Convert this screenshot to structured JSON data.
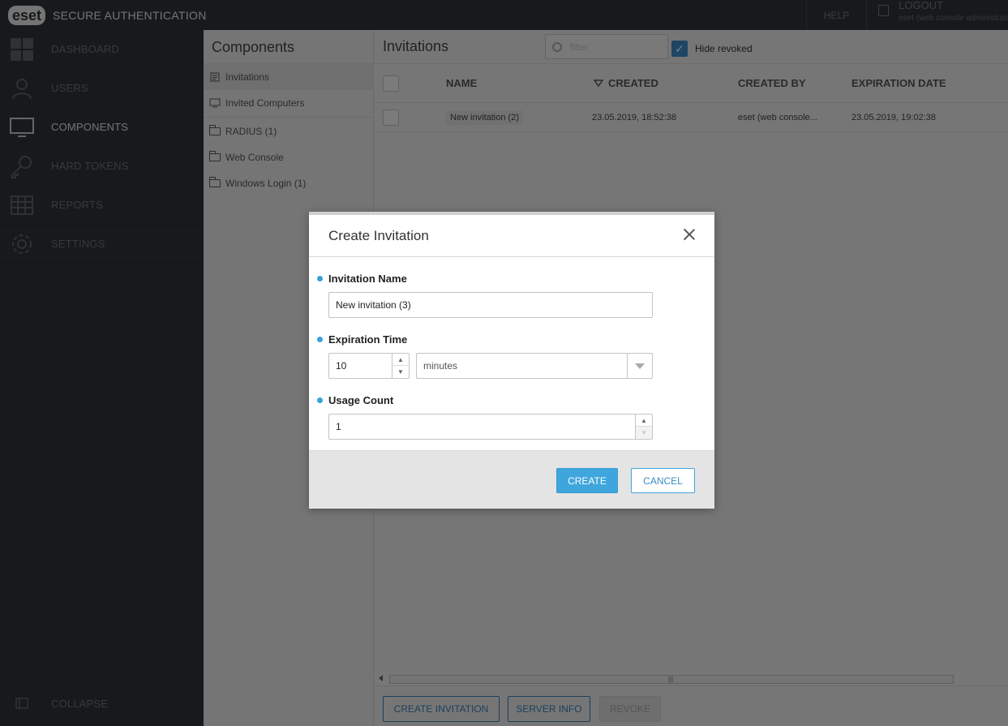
{
  "app": {
    "logo_text": "eset",
    "title": "SECURE AUTHENTICATION",
    "help_label": "HELP",
    "logout_label": "LOGOUT",
    "logout_user": "eset (web console administrator)"
  },
  "sidebar": {
    "items": [
      {
        "label": "DASHBOARD",
        "icon": "dashboard-icon"
      },
      {
        "label": "USERS",
        "icon": "user-icon"
      },
      {
        "label": "COMPONENTS",
        "icon": "monitor-icon",
        "active": true
      },
      {
        "label": "HARD TOKENS",
        "icon": "key-icon"
      },
      {
        "label": "REPORTS",
        "icon": "grid-icon"
      },
      {
        "label": "SETTINGS",
        "icon": "gear-icon"
      }
    ],
    "collapse_label": "COLLAPSE"
  },
  "components": {
    "title": "Components",
    "items": [
      {
        "label": "Invitations",
        "icon": "invitation-icon"
      },
      {
        "label": "Invited Computers",
        "icon": "computer-icon"
      },
      {
        "label": "RADIUS (1)",
        "icon": "folder-icon"
      },
      {
        "label": "Web Console",
        "icon": "folder-icon"
      },
      {
        "label": "Windows Login (1)",
        "icon": "folder-icon"
      }
    ]
  },
  "main": {
    "title": "Invitations",
    "filter_placeholder": "filter",
    "hide_revoked_label": "Hide revoked",
    "columns": [
      "NAME",
      "CREATED",
      "CREATED BY",
      "EXPIRATION DATE"
    ],
    "rows": [
      {
        "name": "New invitation (2)",
        "created": "23.05.2019, 18:52:38",
        "created_by": "eset (web console...",
        "expiration": "23.05.2019, 19:02:38"
      }
    ],
    "buttons": {
      "create_invitation": "CREATE INVITATION",
      "server_info": "SERVER INFO",
      "revoke": "REVOKE"
    }
  },
  "dialog": {
    "title": "Create Invitation",
    "invitation_name_label": "Invitation Name",
    "invitation_name_value": "New invitation (3)",
    "expiration_label": "Expiration Time",
    "expiration_value": "10",
    "expiration_unit": "minutes",
    "usage_label": "Usage Count",
    "usage_value": "1",
    "create_label": "CREATE",
    "cancel_label": "CANCEL"
  },
  "colors": {
    "sidebar_bg": "#2f3438",
    "accent": "#3ea6dc",
    "checkbox_checked": "#3c8dc9"
  }
}
